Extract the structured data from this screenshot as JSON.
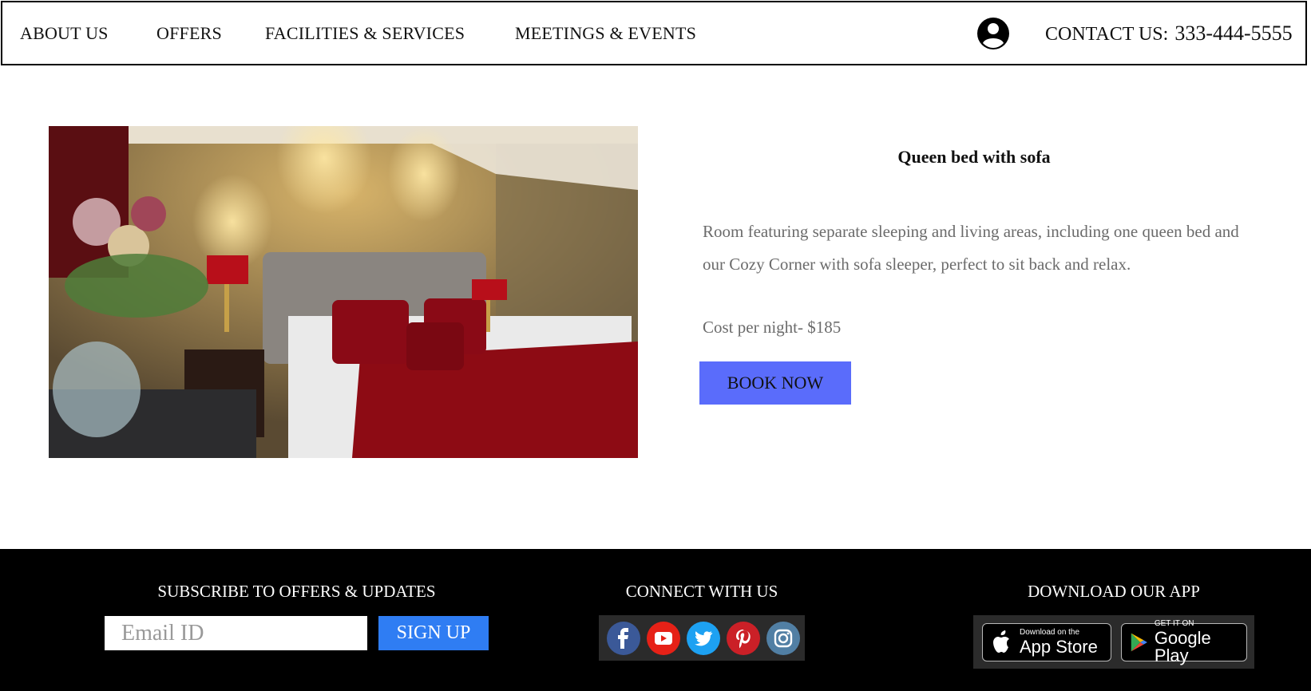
{
  "nav": {
    "about": "ABOUT US",
    "offers": "OFFERS",
    "facilities": "FACILITIES & SERVICES",
    "meetings": "MEETINGS & EVENTS",
    "contact_label": "CONTACT US:",
    "contact_phone": "333-444-5555",
    "account_icon": "user-circle-icon"
  },
  "room": {
    "title": "Queen bed with sofa",
    "description": "Room featuring separate sleeping and living areas, including one queen bed and our Cozy Corner with sofa sleeper, perfect to sit back and relax.",
    "cost": "Cost per night- $185",
    "book_label": "BOOK NOW"
  },
  "footer": {
    "subscribe_heading": "SUBSCRIBE TO OFFERS & UPDATES",
    "email_placeholder": "Email ID",
    "signup_label": "SIGN UP",
    "connect_heading": "CONNECT WITH US",
    "social": [
      {
        "name": "facebook-icon",
        "color": "#3b5998"
      },
      {
        "name": "youtube-icon",
        "color": "#e62117"
      },
      {
        "name": "twitter-icon",
        "color": "#1da1f2"
      },
      {
        "name": "pinterest-icon",
        "color": "#cb2027"
      },
      {
        "name": "instagram-icon",
        "color": "#517fa4"
      }
    ],
    "app_heading": "DOWNLOAD OUR APP",
    "appstore_small": "Download on the",
    "appstore_big": "App Store",
    "googleplay_small": "GET IT ON",
    "googleplay_big": "Google Play"
  },
  "colors": {
    "book_button": "#5a6cfb",
    "signup_button": "#2f7df3",
    "footer_bg": "#000000"
  }
}
